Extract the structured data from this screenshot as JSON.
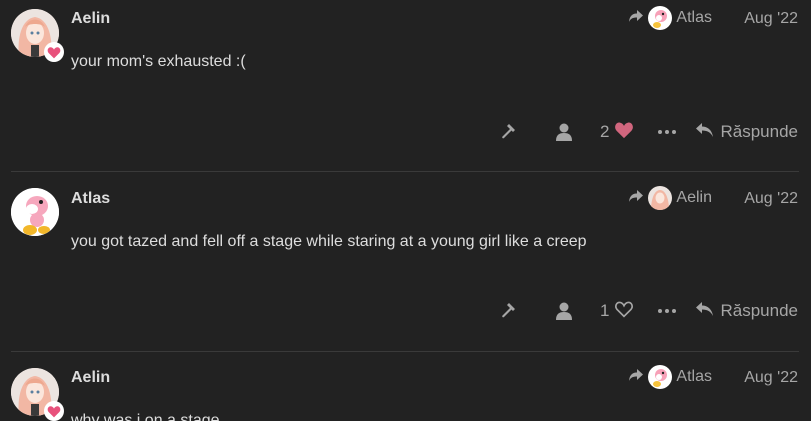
{
  "posts": [
    {
      "username": "Aelin",
      "reply_to": "Atlas",
      "date": "Aug '22",
      "text": "your mom's exhausted :(",
      "like_count": "2",
      "liked": true,
      "reply_label": "Răspunde"
    },
    {
      "username": "Atlas",
      "reply_to": "Aelin",
      "date": "Aug '22",
      "text": "you got tazed and fell off a stage while staring at a young girl like a creep",
      "like_count": "1",
      "liked": false,
      "reply_label": "Răspunde"
    },
    {
      "username": "Aelin",
      "reply_to": "Atlas",
      "date": "Aug '22",
      "text": "why was i on a stage"
    }
  ],
  "colors": {
    "background": "#222222",
    "text": "#dddddd",
    "muted": "#a6a6a6",
    "like": "#d1667e",
    "divider": "#3a3a3a"
  },
  "icons": [
    "reply-arrow-icon",
    "hammer-icon",
    "user-icon",
    "heart-icon",
    "ellipsis-icon",
    "reply-icon"
  ]
}
